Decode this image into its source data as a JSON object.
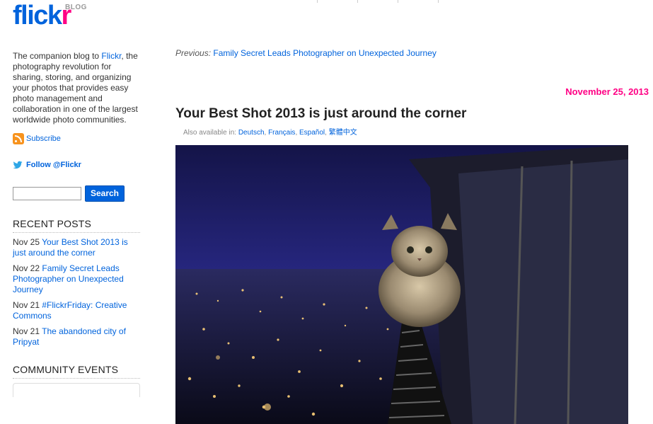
{
  "header": {
    "logo_text_main": "flick",
    "logo_text_accent": "r",
    "logo_badge": "BLOG"
  },
  "sidebar": {
    "about_prefix": "The companion blog to ",
    "about_link": "Flickr",
    "about_suffix": ", the photography revolution for sharing, storing, and organizing your photos that provides easy photo management and collaboration in one of the largest worldwide photo communities.",
    "subscribe_label": "Subscribe",
    "follow_label": "Follow @Flickr",
    "search_placeholder": "",
    "search_button": "Search",
    "recent_title": "RECENT POSTS",
    "recent_posts": [
      {
        "date": "Nov 25",
        "title": "Your Best Shot 2013 is just around the corner"
      },
      {
        "date": "Nov 22",
        "title": "Family Secret Leads Photographer on Unexpected Journey"
      },
      {
        "date": "Nov 21",
        "title": "#FlickrFriday: Creative Commons"
      },
      {
        "date": "Nov 21",
        "title": "The abandoned city of Pripyat"
      }
    ],
    "community_title": "COMMUNITY EVENTS"
  },
  "main": {
    "previous_label": "Previous:",
    "previous_link": "Family Secret Leads Photographer on Unexpected Journey",
    "post_date": "November 25, 2013",
    "post_title": "Your Best Shot 2013 is just around the corner",
    "also_label": "Also available in: ",
    "languages": [
      "Deutsch",
      "Français",
      "Español",
      "繁體中文"
    ]
  },
  "colors": {
    "brand_blue": "#0063dc",
    "brand_pink": "#ff0084"
  }
}
